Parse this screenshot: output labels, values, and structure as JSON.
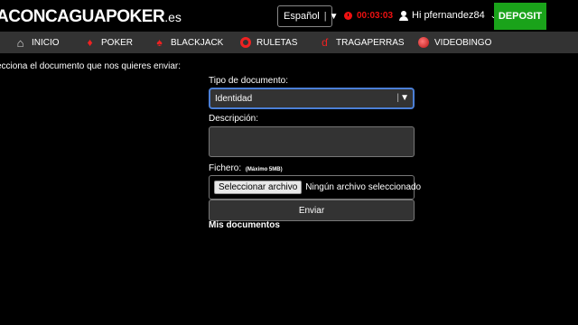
{
  "header": {
    "logo_text": "ACONCAGUAPOKER",
    "logo_tld": ".es",
    "language": "Español",
    "timer": "00:03:03",
    "user": "Hi pfernandez84",
    "deposit_label": "DEPOSIT",
    "colors": {
      "deposit": "#1aa31a",
      "timer": "#e11111"
    }
  },
  "nav": {
    "items": [
      {
        "label": "INICIO",
        "icon": "home-icon"
      },
      {
        "label": "POKER",
        "icon": "poker-chip-icon"
      },
      {
        "label": "BLACKJACK",
        "icon": "cards-icon"
      },
      {
        "label": "RULETAS",
        "icon": "roulette-icon"
      },
      {
        "label": "TRAGAPERRAS",
        "icon": "cherries-icon"
      },
      {
        "label": "VIDEOBINGO",
        "icon": "bingo-ball-icon"
      }
    ]
  },
  "main": {
    "intro": "ecciona el documento que nos quieres enviar:",
    "doc_type_label": "Tipo de documento:",
    "doc_type_value": "Identidad",
    "description_label": "Descripción:",
    "file_label": "Fichero:",
    "file_max": "(Máximo 5MB)",
    "file_button": "Seleccionar archivo",
    "file_status": "Ningún archivo seleccionado",
    "submit_label": "Enviar",
    "my_documents": "Mis documentos"
  }
}
